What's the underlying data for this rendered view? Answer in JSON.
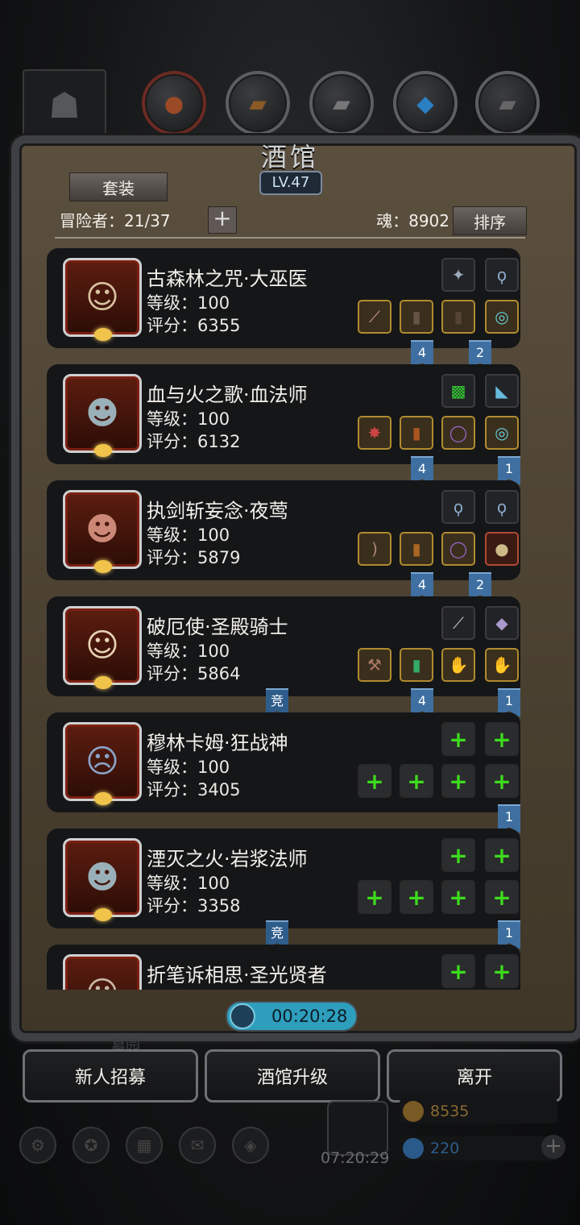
{
  "tavern": {
    "title": "酒馆",
    "level": "LV.47",
    "suit_label": "套装",
    "adventurers_label": "冒险者：21/37",
    "soul_label": "魂：8902",
    "sort_label": "排序"
  },
  "heroes": [
    {
      "name": "古森林之咒·大巫医",
      "level": "等级：100",
      "score": "评分：6355",
      "flags": [
        {
          "text": "4"
        },
        {
          "text": "2"
        }
      ]
    },
    {
      "name": "血与火之歌·血法师",
      "level": "等级：100",
      "score": "评分：6132",
      "flags": [
        {
          "text": "4"
        },
        {
          "text": "1"
        }
      ]
    },
    {
      "name": "执剑斩妄念·夜莺",
      "level": "等级：100",
      "score": "评分：5879",
      "flags": [
        {
          "text": "4"
        },
        {
          "text": "2"
        }
      ]
    },
    {
      "name": "破厄使·圣殿骑士",
      "level": "等级：100",
      "score": "评分：5864",
      "flags": [
        {
          "text": "竞"
        },
        {
          "text": "4"
        },
        {
          "text": "1"
        }
      ]
    },
    {
      "name": "穆林卡姆·狂战神",
      "level": "等级：100",
      "score": "评分：3405",
      "flags": [
        {
          "text": "1"
        }
      ]
    },
    {
      "name": "湮灭之火·岩浆法师",
      "level": "等级：100",
      "score": "评分：3358",
      "flags": [
        {
          "text": "竞"
        },
        {
          "text": "1"
        }
      ]
    },
    {
      "name": "折笔诉相思·圣光贤者",
      "level": "",
      "score": "",
      "flags": []
    }
  ],
  "timer": "00:20:28",
  "grave_label": "墓园",
  "buttons": {
    "recruit": "新人招募",
    "upgrade": "酒馆升级",
    "leave": "离开"
  },
  "hud": {
    "gift_time": "07:20:29",
    "gold": "8535",
    "gems": "220"
  },
  "colors": {
    "flag_blue": "#3e6fa0",
    "plus_green": "#3ddc1d",
    "timer_teal": "#2e9ebd"
  }
}
